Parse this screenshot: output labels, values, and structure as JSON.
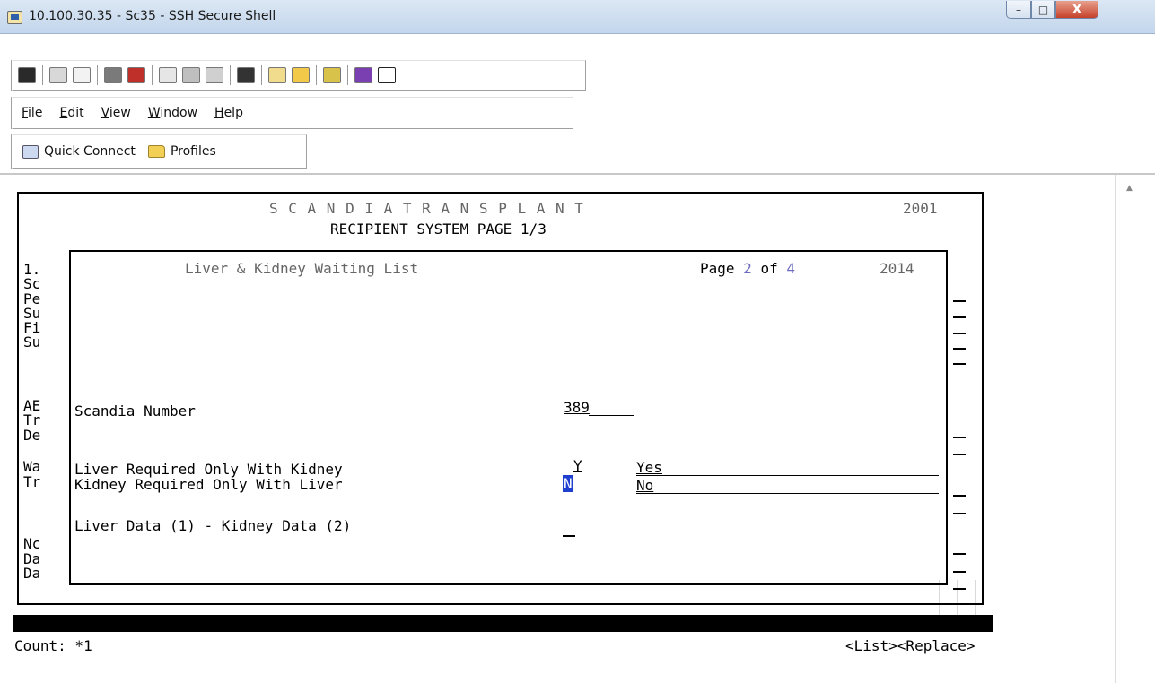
{
  "window": {
    "title": "10.100.30.35 - Sc35 - SSH Secure Shell",
    "controls": {
      "minimize": "–",
      "maximize": "□",
      "close": "X"
    }
  },
  "menu": [
    {
      "label": "File",
      "accel": "F",
      "rest": "ile"
    },
    {
      "label": "Edit",
      "accel": "E",
      "rest": "dit"
    },
    {
      "label": "View",
      "accel": "V",
      "rest": "iew"
    },
    {
      "label": "Window",
      "accel": "W",
      "rest": "indow"
    },
    {
      "label": "Help",
      "accel": "H",
      "rest": "elp"
    }
  ],
  "quickbar": {
    "quick_connect": "Quick Connect",
    "profiles": "Profiles"
  },
  "toolbar_icons": [
    "save-icon",
    "print-icon",
    "print-preview-icon",
    "disconnect-icon",
    "delete-icon",
    "copy-icon",
    "paste-icon",
    "paste-special-icon",
    "find-icon",
    "new-terminal-icon",
    "new-file-transfer-icon",
    "settings-icon",
    "help-topics-icon",
    "context-help-icon"
  ],
  "terminal": {
    "header_spaced": "S C A N D I A T R A N S P L A N T",
    "header_year": "2001",
    "header_subtitle": "RECIPIENT SYSTEM PAGE 1/3",
    "left_fragments": [
      "1.",
      "Sc",
      "Pe",
      "Su",
      "Fi",
      "Su",
      "AE",
      "Tr",
      "De",
      "Wa",
      "Tr",
      "Nc",
      "Da",
      "Da"
    ],
    "popup": {
      "title": "Liver & Kidney Waiting List",
      "page_label": "Page",
      "page_num": "2",
      "of_label": "of",
      "page_total": "4",
      "year": "2014",
      "scandia_label": "Scandia Number",
      "scandia_value": "389",
      "liver_req_label": "Liver Required Only With Kidney",
      "liver_req_value": "Y",
      "liver_req_desc": "Yes",
      "kidney_req_label": "Kidney Required Only With Liver",
      "kidney_req_value": "N",
      "kidney_req_desc": "No",
      "data_choice_label": "Liver Data (1) - Kidney Data (2)",
      "data_choice_value": ""
    },
    "status": {
      "count": "Count: *1",
      "actions": "<List><Replace>"
    }
  }
}
